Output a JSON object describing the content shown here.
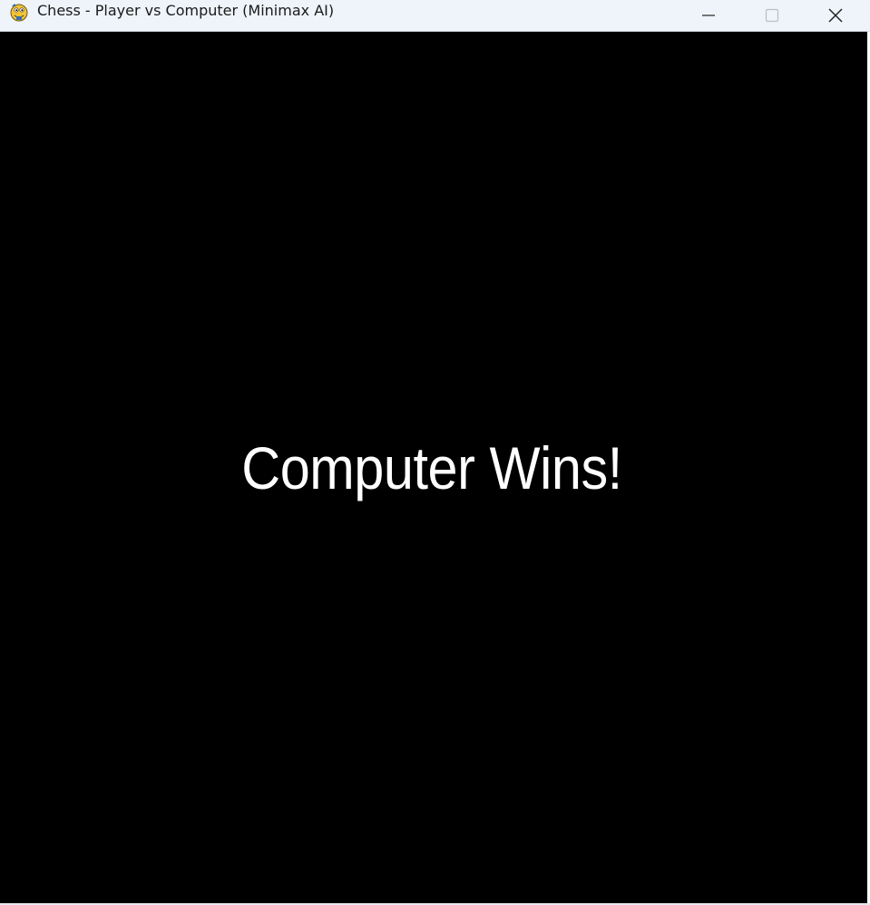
{
  "window": {
    "title": "Chess - Player vs Computer (Minimax AI)",
    "app_icon": "python-snake-icon",
    "controls": {
      "minimize_icon": "minimize-icon",
      "maximize_icon": "maximize-icon",
      "close_icon": "close-icon"
    }
  },
  "game": {
    "result_message": "Computer Wins!",
    "background_color": "#000000",
    "text_color": "#ffffff"
  }
}
